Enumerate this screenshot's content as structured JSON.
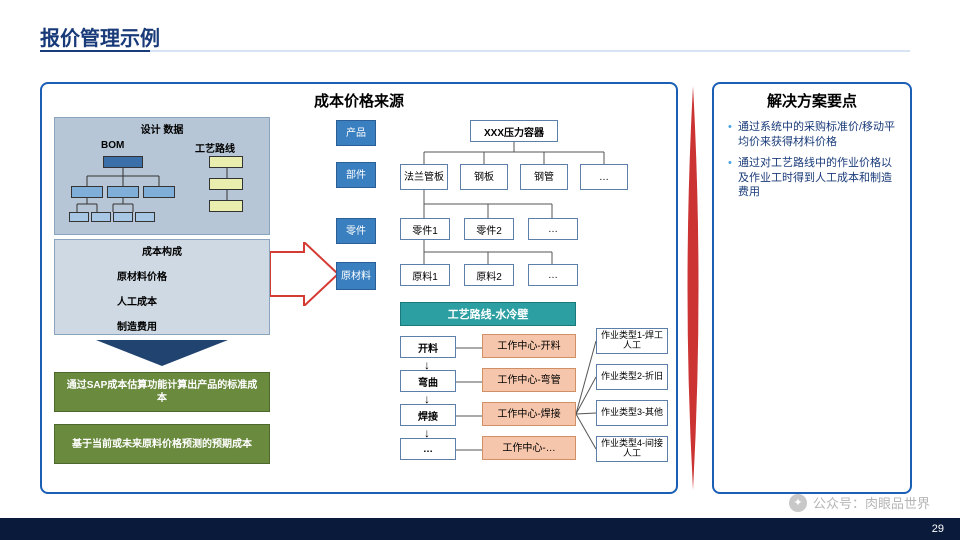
{
  "title": "报价管理示例",
  "page_number": "29",
  "watermark": "公众号：肉眼品世界",
  "left_panel": {
    "title": "成本价格来源",
    "design": {
      "title": "设计 数据",
      "sub_bom": "BOM",
      "sub_route": "工艺路线"
    },
    "cost": {
      "title": "成本构成",
      "items": [
        "原材料价格",
        "人工成本",
        "制造费用"
      ]
    },
    "green": [
      "通过SAP成本估算功能计算出产品的标准成本",
      "基于当前或未来原料价格预测的预期成本"
    ],
    "row_labels": [
      "产品",
      "部件",
      "零件",
      "原材料"
    ],
    "product": "XXX压力容器",
    "components": [
      "法兰管板",
      "钢板",
      "钢管",
      "…"
    ],
    "parts": [
      "零件1",
      "零件2",
      "…"
    ],
    "materials": [
      "原料1",
      "原料2",
      "…"
    ],
    "route_title": "工艺路线-水冷壁",
    "steps": [
      "开料",
      "弯曲",
      "焊接",
      "…"
    ],
    "work_centers": [
      "工作中心-开料",
      "工作中心-弯管",
      "工作中心-焊接",
      "工作中心-…"
    ],
    "activities": [
      "作业类型1-焊工人工",
      "作业类型2-折旧",
      "作业类型3-其他",
      "作业类型4-间接人工"
    ]
  },
  "right_panel": {
    "title": "解决方案要点",
    "bullets": [
      "通过系统中的采购标准价/移动平均价来获得材料价格",
      "通过对工艺路线中的作业价格以及作业工时得到人工成本和制造费用"
    ]
  }
}
